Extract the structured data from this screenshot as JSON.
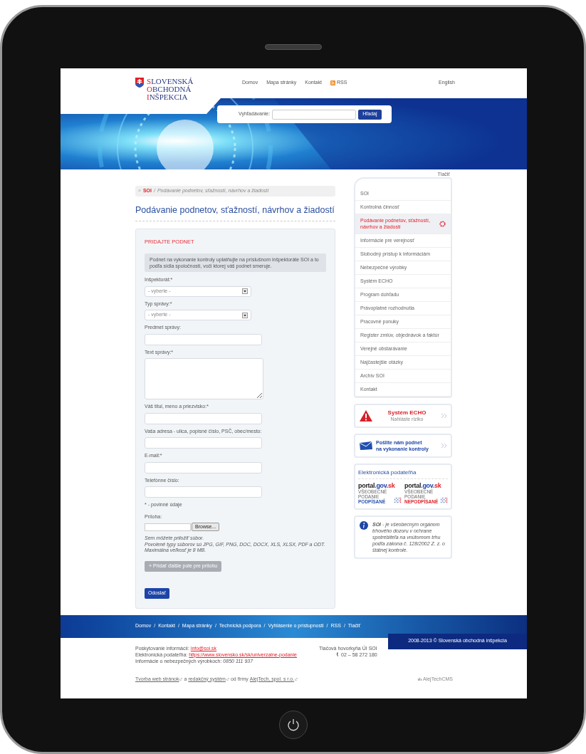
{
  "header": {
    "logo_lines": [
      "SLOVENSKÁ",
      "OBCHODNÁ",
      "INŠPEKCIA"
    ],
    "nav": [
      {
        "label": "Domov",
        "kind": "link"
      },
      {
        "label": "Mapa stránky",
        "kind": "link"
      },
      {
        "label": "Kontakt",
        "kind": "link"
      },
      {
        "label": "RSS",
        "kind": "rss"
      }
    ],
    "language": "English",
    "search": {
      "label": "Vyhľadávanie:",
      "button": "Hľadaj"
    }
  },
  "print": "Tlačiť",
  "breadcrumb": {
    "marker": "»",
    "separator": "/",
    "items": [
      "SOI",
      "Podávanie podnetov, sťažností, návrhov a žiadostí"
    ]
  },
  "title": "Podávanie podnetov, sťažností, návrhov a žiadostí",
  "form": {
    "heading": "PRIDAJTE PODNET",
    "notice": "Podnet na vykonanie kontroly uplatňujte na príslušnom inšpektoráte SOI a to podľa sídla spoločnosti, voči ktorej váš podnet smeruje.",
    "fields": [
      {
        "label": "Inšpektorát:*",
        "kind": "select",
        "placeholder": "- vyberte -"
      },
      {
        "label": "Typ správy:*",
        "kind": "select",
        "placeholder": "- vyberte -"
      },
      {
        "label": "Predmet správy:",
        "kind": "text"
      },
      {
        "label": "Text správy:*",
        "kind": "textarea"
      },
      {
        "label": "Váš titul, meno a priezvisko:*",
        "kind": "text"
      },
      {
        "label": "Vaša adresa - ulica, popisné číslo, PSČ, obec/mesto:",
        "kind": "text"
      },
      {
        "label": "E-mail:*",
        "kind": "text"
      },
      {
        "label": "Telefónne číslo:",
        "kind": "text"
      }
    ],
    "required_note": "* - povinné údaje",
    "attachment": {
      "label": "Príloha:",
      "button": "Browse..."
    },
    "hints": [
      "Sem môžete priložiť súbor.",
      "Povolené typy súborov sú JPG, GIF, PNG, DOC, DOCX, XLS, XLSX, PDF a ODT.",
      "Maximálna veľkosť je 8 MB."
    ],
    "add_button": {
      "label": "+ Pridať ďalšie pole pre prílohu",
      "disabled": true
    },
    "submit": "Odoslať"
  },
  "sidebar": {
    "items": [
      {
        "label": "SOI",
        "selected": false
      },
      {
        "label": "Kontrolná činnosť",
        "selected": false
      },
      {
        "label": "Podávanie podnetov, sťažností, návrhov a žiadostí",
        "selected": true
      },
      {
        "label": "Informácie pre verejnosť",
        "selected": false
      },
      {
        "label": "Slobodný prístup k informáciám",
        "selected": false
      },
      {
        "label": "Nebezpečné výrobky",
        "selected": false
      },
      {
        "label": "Systém ECHO",
        "selected": false
      },
      {
        "label": "Program dohľadu",
        "selected": false
      },
      {
        "label": "Právoplatné rozhodnutia",
        "selected": false
      },
      {
        "label": "Pracovné ponuky",
        "selected": false
      },
      {
        "label": "Register zmlúv, objednávok a faktúr",
        "selected": false
      },
      {
        "label": "Verejné obstarávanie",
        "selected": false
      },
      {
        "label": "Najčastejšie otázky",
        "selected": false
      },
      {
        "label": "Archív SOI",
        "selected": false
      },
      {
        "label": "Kontakt",
        "selected": false
      }
    ],
    "promos": [
      {
        "kind": "warning",
        "title": "Systém ECHO",
        "subtitle": "Nahláste riziko"
      },
      {
        "kind": "mail",
        "title": "Pošlite nám podnet",
        "subtitle": "na vykonanie kontroly"
      }
    ],
    "podatelna": {
      "title": "Elektronická podateľňa",
      "portals": [
        {
          "logo": [
            "portal",
            ".gov",
            ".sk"
          ],
          "caption": [
            "VŠEOBECNÉ",
            "PODANIE"
          ],
          "status": "PODPÍSANÉ",
          "color": "#2b57b5"
        },
        {
          "logo": [
            "portal",
            ".gov",
            ".sk"
          ],
          "caption": [
            "VŠEOBECNÉ",
            "PODANIE"
          ],
          "status": "NEPODPÍSANÉ",
          "color": "#e0202a"
        }
      ]
    },
    "info": "**SOI** - je všeobecným orgánom trhového dozoru v ochrane spotrebiteľa na vnútornom trhu podľa zákona č. 128/2002 Z. z. o štátnej kontrole."
  },
  "footer": {
    "links": [
      "Domov",
      "Kontakt",
      "Mapa stránky",
      "Technická podpora",
      "Vyhlásenie o prístupnosti",
      "RSS",
      "Tlačiť"
    ],
    "separator": "/",
    "copyright": "2008-2013 © Slovenská obchodná inšpekcia",
    "contacts": [
      {
        "text": "Poskytovanie informácií:",
        "link": "info@soi.sk"
      },
      {
        "text": "Elektronická podateľňa:",
        "link": "https://www.slovensko.sk/sk/univerzalne-podanie"
      },
      {
        "text": "Informácie o nebezpečných výrobkoch:",
        "value": "0850 111 937"
      }
    ],
    "press": {
      "title": "Tlačová hovorkyňa ÚI SOI",
      "phone": "02 – 58 272 180"
    },
    "credits": [
      {
        "kind": "link",
        "text": "Tvorba web stránok"
      },
      {
        "kind": "text",
        "text": "a"
      },
      {
        "kind": "link",
        "text": "redakčný systém"
      },
      {
        "kind": "text",
        "text": "od firmy"
      },
      {
        "kind": "link",
        "text": "AlejTech, spol. s r.o."
      }
    ],
    "cms": "AlejTechCMS"
  }
}
